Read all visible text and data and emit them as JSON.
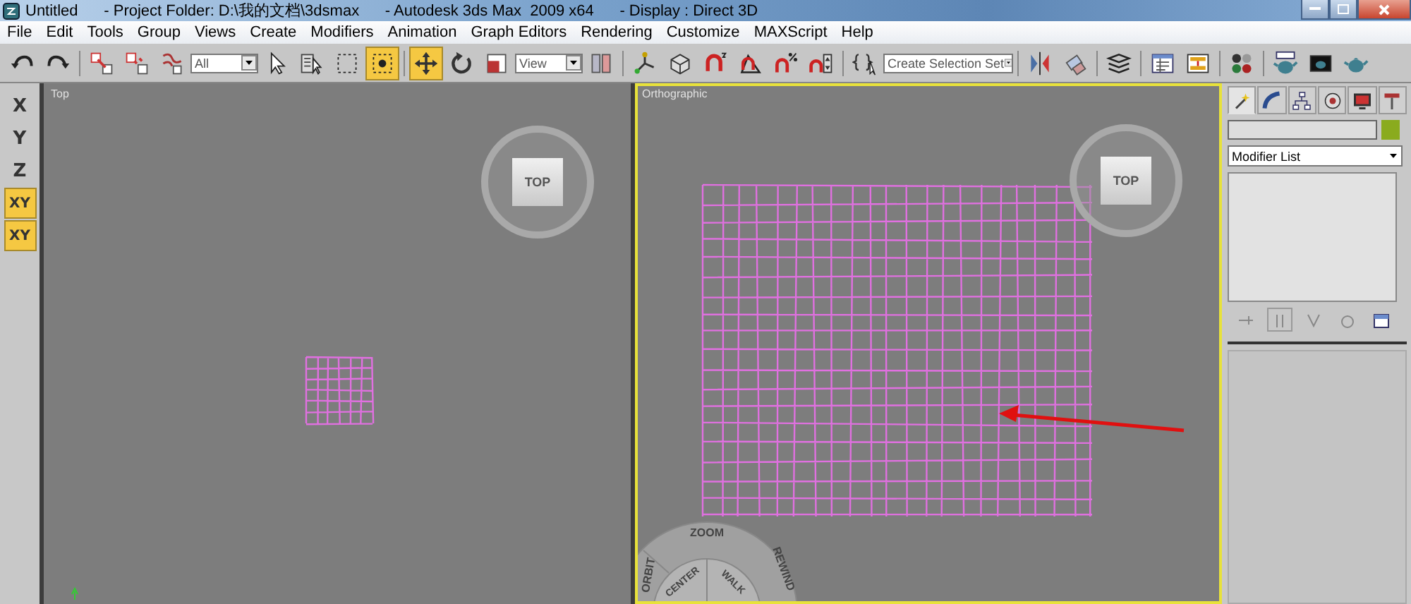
{
  "window": {
    "title": "Untitled      - Project Folder: D:\\我的文档\\3dsmax      - Autodesk 3ds Max  2009 x64      - Display : Direct 3D"
  },
  "menu": [
    "File",
    "Edit",
    "Tools",
    "Group",
    "Views",
    "Create",
    "Modifiers",
    "Animation",
    "Graph Editors",
    "Rendering",
    "Customize",
    "MAXScript",
    "Help"
  ],
  "toolbar": [
    {
      "kind": "button",
      "selected": false
    },
    {
      "kind": "button",
      "selected": false
    },
    {
      "kind": "separator"
    },
    {
      "kind": "button",
      "selected": false
    },
    {
      "kind": "button",
      "selected": false
    },
    {
      "kind": "button",
      "selected": false
    },
    {
      "kind": "dropdown",
      "value": "All"
    },
    {
      "kind": "button",
      "selected": false
    },
    {
      "kind": "button",
      "selected": false
    },
    {
      "kind": "button",
      "selected": false
    },
    {
      "kind": "button",
      "selected": true
    },
    {
      "kind": "separator"
    },
    {
      "kind": "button",
      "selected": true
    },
    {
      "kind": "button",
      "selected": false
    },
    {
      "kind": "button",
      "selected": false
    },
    {
      "kind": "dropdown",
      "value": "View"
    },
    {
      "kind": "button",
      "selected": false
    },
    {
      "kind": "separator"
    },
    {
      "kind": "button",
      "selected": false
    },
    {
      "kind": "button",
      "selected": false
    },
    {
      "kind": "button",
      "selected": false
    },
    {
      "kind": "button",
      "selected": false
    },
    {
      "kind": "button",
      "selected": false
    },
    {
      "kind": "button",
      "selected": false
    },
    {
      "kind": "separator"
    },
    {
      "kind": "button",
      "selected": false
    },
    {
      "kind": "dropdown",
      "value": "Create Selection Set"
    },
    {
      "kind": "separator"
    },
    {
      "kind": "button",
      "selected": false
    },
    {
      "kind": "button",
      "selected": false
    },
    {
      "kind": "separator"
    },
    {
      "kind": "button",
      "selected": false
    },
    {
      "kind": "separator"
    },
    {
      "kind": "button",
      "selected": false
    },
    {
      "kind": "button",
      "selected": false
    },
    {
      "kind": "separator"
    },
    {
      "kind": "button",
      "selected": false
    },
    {
      "kind": "separator"
    },
    {
      "kind": "button",
      "selected": false
    },
    {
      "kind": "button",
      "selected": false
    },
    {
      "kind": "button",
      "selected": false
    }
  ],
  "axis_buttons": [
    {
      "label": "X",
      "selected": false
    },
    {
      "label": "Y",
      "selected": false
    },
    {
      "label": "Z",
      "selected": false
    },
    {
      "label": "XY",
      "selected": true
    },
    {
      "label": "XY",
      "selected": true
    }
  ],
  "viewports": [
    {
      "label": "Top",
      "active": false,
      "viewcube": "TOP"
    },
    {
      "label": "Orthographic",
      "active": true,
      "viewcube": "TOP",
      "wheel": [
        "ZOOM",
        "CENTER",
        "WALK",
        "ORBIT",
        "REWIND"
      ]
    }
  ],
  "command_panel": {
    "tabs": [
      {
        "selected": true
      },
      {
        "selected": false
      },
      {
        "selected": false
      },
      {
        "selected": false
      },
      {
        "selected": false
      },
      {
        "selected": false
      }
    ],
    "modifier_list": "Modifier List"
  }
}
